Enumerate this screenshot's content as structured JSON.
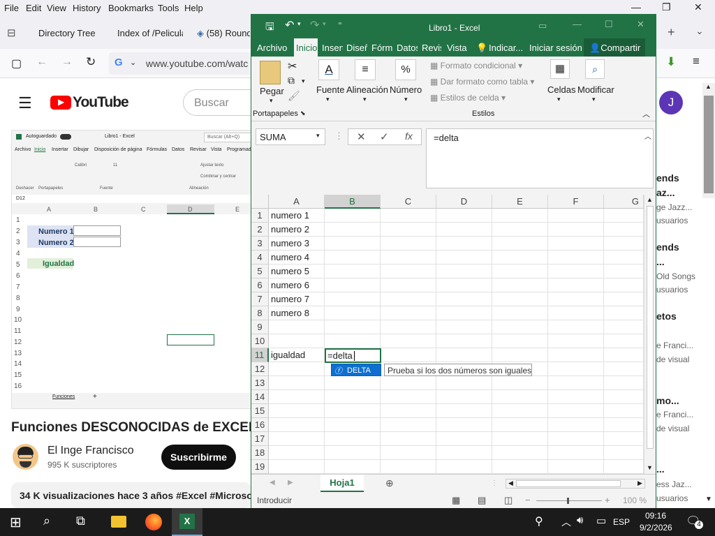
{
  "browser": {
    "menu": [
      "File",
      "Edit",
      "View",
      "History",
      "Bookmarks",
      "Tools",
      "Help"
    ],
    "tabs": [
      "Directory Tree",
      "Index of /Pelicula",
      "(58) Round"
    ],
    "url": "www.youtube.com/watc"
  },
  "youtube": {
    "logo_text": "YouTube",
    "search_placeholder": "Buscar",
    "video_title": "Funciones DESCONOCIDAS de EXCEL",
    "channel_name": "El Inge Francisco",
    "subscribers": "995 K suscriptores",
    "subscribe_label": "Suscribirme",
    "views_line": "34 K visualizaciones  hace 3 años  #Excel #Microsof",
    "avatar_letter": "J",
    "side_items": [
      "ends",
      "az...",
      "ge Jazz...",
      "usuarios",
      "ends",
      "...",
      "Old Songs",
      "usuarios",
      "etos",
      "e Franci...",
      "de visual",
      "mo...",
      "e Franci...",
      "de visual",
      "...",
      "ess Jaz...",
      "usuarios"
    ],
    "mini_excel": {
      "title": "Libro1 - Excel",
      "autosave": "Autoguardado",
      "search": "Buscar (Alt+Q)",
      "menus": [
        "Archivo",
        "Inicio",
        "Insertar",
        "Dibujar",
        "Disposición de página",
        "Fórmulas",
        "Datos",
        "Revisar",
        "Vista",
        "Programad"
      ],
      "namebox": "D12",
      "columns": [
        "A",
        "B",
        "C",
        "D",
        "E"
      ],
      "rows": [
        "1",
        "2",
        "3",
        "4",
        "5",
        "6",
        "7",
        "8",
        "9",
        "10",
        "11",
        "12",
        "13",
        "14",
        "15",
        "16"
      ],
      "labels": [
        "Numero 1",
        "Numero 2",
        "Igualdad"
      ],
      "sheet_tab": "Funciones",
      "font": "Calibri",
      "size": "11",
      "wrap": "Ajustar texto",
      "merge": "Combinar y centrar",
      "groups": [
        "Deshacer",
        "Portapapeles",
        "Fuente",
        "Alineación"
      ]
    }
  },
  "excel": {
    "title": "Libro1 - Excel",
    "menus": [
      "Archivo",
      "Inicio",
      "Insert",
      "Diseñ",
      "Fórm",
      "Datos",
      "Revis",
      "Vista"
    ],
    "indicar": "Indicar...",
    "signin": "Iniciar sesión",
    "share": "Compartir",
    "ribbon": {
      "paste": "Pegar",
      "font": "Fuente",
      "alignment": "Alineación",
      "number": "Número",
      "cond_format": "Formato condicional",
      "table_format": "Dar formato como tabla",
      "cell_styles": "Estilos de celda",
      "cells": "Celdas",
      "modify": "Modificar",
      "clipboard": "Portapapeles",
      "styles": "Estilos",
      "percent": "%"
    },
    "namebox": "SUMA",
    "formula": "=delta",
    "columns": [
      "A",
      "B",
      "C",
      "D",
      "E",
      "F",
      "G"
    ],
    "rows": [
      "1",
      "2",
      "3",
      "4",
      "5",
      "6",
      "7",
      "8",
      "9",
      "10",
      "11",
      "12",
      "13",
      "14",
      "15",
      "16",
      "17",
      "18",
      "19"
    ],
    "cells_a": [
      "numero 1",
      "numero 2",
      "numero 3",
      "numero 4",
      "numero 5",
      "numero 6",
      "numero 7",
      "numero 8",
      "",
      "",
      "igualdad"
    ],
    "active_cell_text": "=delta",
    "autocomplete": "DELTA",
    "tooltip": "Prueba si los dos números son iguales",
    "sheet": "Hoja1",
    "status": "Introducir",
    "zoom": "100 %"
  },
  "taskbar": {
    "lang": "ESP",
    "time": "09:16",
    "date": "9/2/2026",
    "notif_count": "4"
  },
  "colors": {
    "excel_green": "#217346",
    "yt_red": "#ff0000"
  }
}
